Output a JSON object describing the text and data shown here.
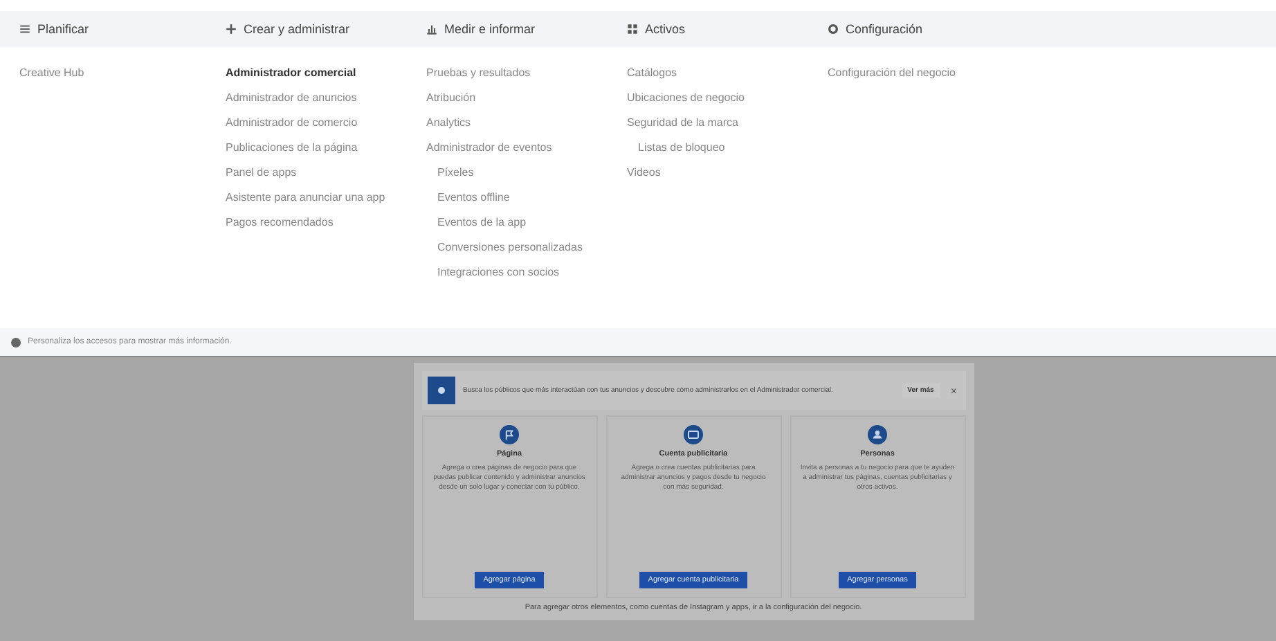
{
  "menu": {
    "columns": [
      {
        "title": "Planificar",
        "items": [
          {
            "label": "Creative Hub",
            "bold": false
          }
        ]
      },
      {
        "title": "Crear y administrar",
        "items": [
          {
            "label": "Administrador comercial",
            "bold": true
          },
          {
            "label": "Administrador de anuncios",
            "bold": false
          },
          {
            "label": "Administrador de comercio",
            "bold": false
          },
          {
            "label": "Publicaciones de la página",
            "bold": false
          },
          {
            "label": "Panel de apps",
            "bold": false
          },
          {
            "label": "Asistente para anunciar una app",
            "bold": false
          },
          {
            "label": "Pagos recomendados",
            "bold": false
          }
        ]
      },
      {
        "title": "Medir e informar",
        "items": [
          {
            "label": "Pruebas y resultados",
            "bold": false
          },
          {
            "label": "Atribución",
            "bold": false
          },
          {
            "label": "Analytics",
            "bold": false
          },
          {
            "label": "Administrador de eventos",
            "bold": false,
            "children": [
              {
                "label": "Píxeles"
              },
              {
                "label": "Eventos offline"
              },
              {
                "label": "Eventos de la app"
              },
              {
                "label": "Conversiones personalizadas"
              },
              {
                "label": "Integraciones con socios"
              }
            ]
          }
        ]
      },
      {
        "title": "Activos",
        "items": [
          {
            "label": "Catálogos",
            "bold": false
          },
          {
            "label": "Ubicaciones de negocio",
            "bold": false
          },
          {
            "label": "Seguridad de la marca",
            "bold": false,
            "children": [
              {
                "label": "Listas de bloqueo"
              }
            ]
          },
          {
            "label": "Videos",
            "bold": false
          }
        ]
      },
      {
        "title": "Configuración",
        "items": [
          {
            "label": "Configuración del negocio",
            "bold": false
          }
        ]
      }
    ],
    "footer": "Personaliza los accesos para mostrar más información."
  },
  "dialog": {
    "banner": "Busca los públicos que más interactúan con tus anuncios y descubre cómo administrarlos en el Administrador comercial.",
    "banner_button": "Ver más",
    "close": "×",
    "cards": [
      {
        "title": "Página",
        "text": "Agrega o crea páginas de negocio para que puedas publicar contenido y administrar anuncios desde un solo lugar y conectar con tu público.",
        "button": "Agregar página"
      },
      {
        "title": "Cuenta publicitaria",
        "text": "Agrega o crea cuentas publicitarias para administrar anuncios y pagos desde tu negocio con más seguridad.",
        "button": "Agregar cuenta publicitaria"
      },
      {
        "title": "Personas",
        "text": "Invita a personas a tu negocio para que te ayuden a administrar tus páginas, cuentas publicitarias y otros activos.",
        "button": "Agregar personas"
      }
    ],
    "footer": "Para agregar otros elementos, como cuentas de Instagram y apps, ir a la configuración del negocio."
  }
}
